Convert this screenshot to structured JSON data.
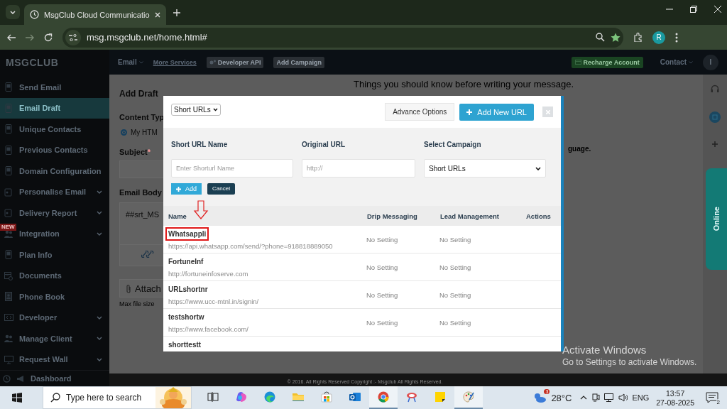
{
  "browser": {
    "tab_title": "MsgClub Cloud Communicatio",
    "url": "msg.msgclub.net/home.html#",
    "profile_initial": "R"
  },
  "app": {
    "logo": "MSGCLUB",
    "header": {
      "menu": "Email",
      "link": "More Services",
      "buttons": [
        "Developer API",
        "Add Campaign"
      ],
      "recharge": "Recharge Account",
      "contact": "Contact",
      "avatar": "I"
    },
    "sidebar": {
      "items": [
        {
          "label": "Send Email",
          "selected": false,
          "expandable": false
        },
        {
          "label": "Email Draft",
          "selected": true,
          "expandable": false
        },
        {
          "label": "Unique Contacts",
          "selected": false,
          "expandable": false
        },
        {
          "label": "Previous Contacts",
          "selected": false,
          "expandable": false
        },
        {
          "label": "Domain Configuration",
          "selected": false,
          "expandable": false
        },
        {
          "label": "Personalise Email",
          "selected": false,
          "expandable": true
        },
        {
          "label": "Delivery Report",
          "selected": false,
          "expandable": true
        },
        {
          "label": "Integration",
          "selected": false,
          "expandable": true,
          "badge": "NEW"
        },
        {
          "label": "Plan Info",
          "selected": false,
          "expandable": false
        },
        {
          "label": "Documents",
          "selected": false,
          "expandable": false
        },
        {
          "label": "Phone Book",
          "selected": false,
          "expandable": false
        },
        {
          "label": "Developer",
          "selected": false,
          "expandable": true
        },
        {
          "label": "Manage Client",
          "selected": false,
          "expandable": true
        },
        {
          "label": "Request Wall",
          "selected": false,
          "expandable": true
        }
      ],
      "bottom_link": "Dashboard"
    },
    "content": {
      "title": "Add Draft",
      "content_type_label": "Content Typ",
      "radio": {
        "label": "My HTM",
        "selected": true
      },
      "subject_label": "Subject",
      "required_mark": "*",
      "body_label": "Email Body",
      "body_text": "##srt_MS",
      "attach": "Attach",
      "max_size": "Max file size",
      "notice": "Things you should know before writing your message.",
      "notice_tail": "guage."
    },
    "online_tab": "Online",
    "copyright": "© 2016. All Rights Reserved Copyright :- Msgclub All Rights Reserved."
  },
  "modal": {
    "type_select": "Short URLs",
    "advance_button": "Advance Options",
    "add_new_button": "Add New URL",
    "form": {
      "fields": [
        {
          "label": "Short URL Name",
          "placeholder": "Enter Shorturl Name"
        },
        {
          "label": "Original URL",
          "placeholder": "http://"
        }
      ],
      "campaign": {
        "label": "Select Campaign",
        "value": "Short URLs"
      },
      "add_button": "Add",
      "cancel_button": "Cancel"
    },
    "table": {
      "columns": [
        "Name",
        "Drip Messaging",
        "Lead Management",
        "Actions"
      ],
      "rows": [
        {
          "name": "Whatsappli",
          "url": "https://api.whatsapp.com/send/?phone=918818889050",
          "drip": "No Setting",
          "lead": "No Setting",
          "highlighted": true
        },
        {
          "name": "FortuneInf",
          "url": "http://fortuneinfoserve.com",
          "drip": "No Setting",
          "lead": "No Setting",
          "highlighted": false
        },
        {
          "name": "URLshortnr",
          "url": "https://www.ucc-mtnl.in/signin/",
          "drip": "No Setting",
          "lead": "No Setting",
          "highlighted": false
        },
        {
          "name": "testshortw",
          "url": "https://www.facebook.com/",
          "drip": "No Setting",
          "lead": "No Setting",
          "highlighted": false
        },
        {
          "name": "shorttestt",
          "highlighted": false
        }
      ]
    }
  },
  "os": {
    "activation": {
      "title": "Activate Windows",
      "text": "Go to Settings to activate Windows."
    },
    "taskbar": {
      "search_placeholder": "Type here to search",
      "apps": [
        {
          "kind": "task-view",
          "active": false
        },
        {
          "kind": "copilot",
          "active": false
        },
        {
          "kind": "edge",
          "active": false
        },
        {
          "kind": "explorer",
          "active": false
        },
        {
          "kind": "store",
          "active": false
        },
        {
          "kind": "outlook",
          "active": false
        },
        {
          "kind": "chrome",
          "active": true
        },
        {
          "kind": "snipping",
          "active": false
        },
        {
          "kind": "sticky",
          "active": false
        },
        {
          "kind": "paint",
          "active": true
        }
      ],
      "weather": {
        "temp": "28°C",
        "badge": "3"
      },
      "language": "ENG",
      "time": "13:57",
      "date": "27-08-2025",
      "notifications": "2"
    }
  }
}
